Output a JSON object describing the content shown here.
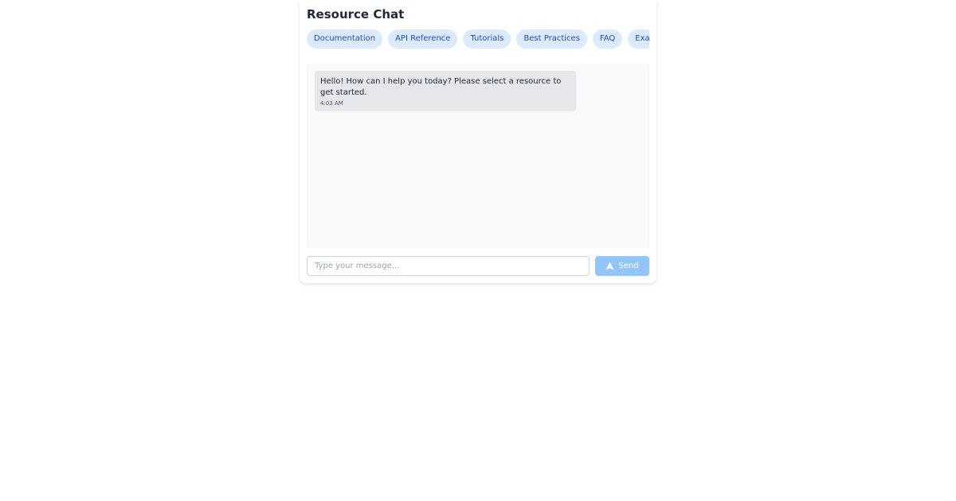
{
  "header": {
    "title": "Resource Chat"
  },
  "tabs": [
    {
      "label": "Documentation"
    },
    {
      "label": "API Reference"
    },
    {
      "label": "Tutorials"
    },
    {
      "label": "Best Practices"
    },
    {
      "label": "FAQ"
    },
    {
      "label": "Examples"
    }
  ],
  "messages": [
    {
      "text": "Hello! How can I help you today? Please select a resource to get started.",
      "time": "4:03 AM"
    }
  ],
  "composer": {
    "placeholder": "Type your message...",
    "value": "",
    "send_label": "Send",
    "send_icon": "send-icon"
  },
  "colors": {
    "accent": "#93c5fd",
    "tab_bg": "#dbeafe",
    "tab_text": "#1e4fb8",
    "bubble_bg": "#e5e7eb"
  }
}
